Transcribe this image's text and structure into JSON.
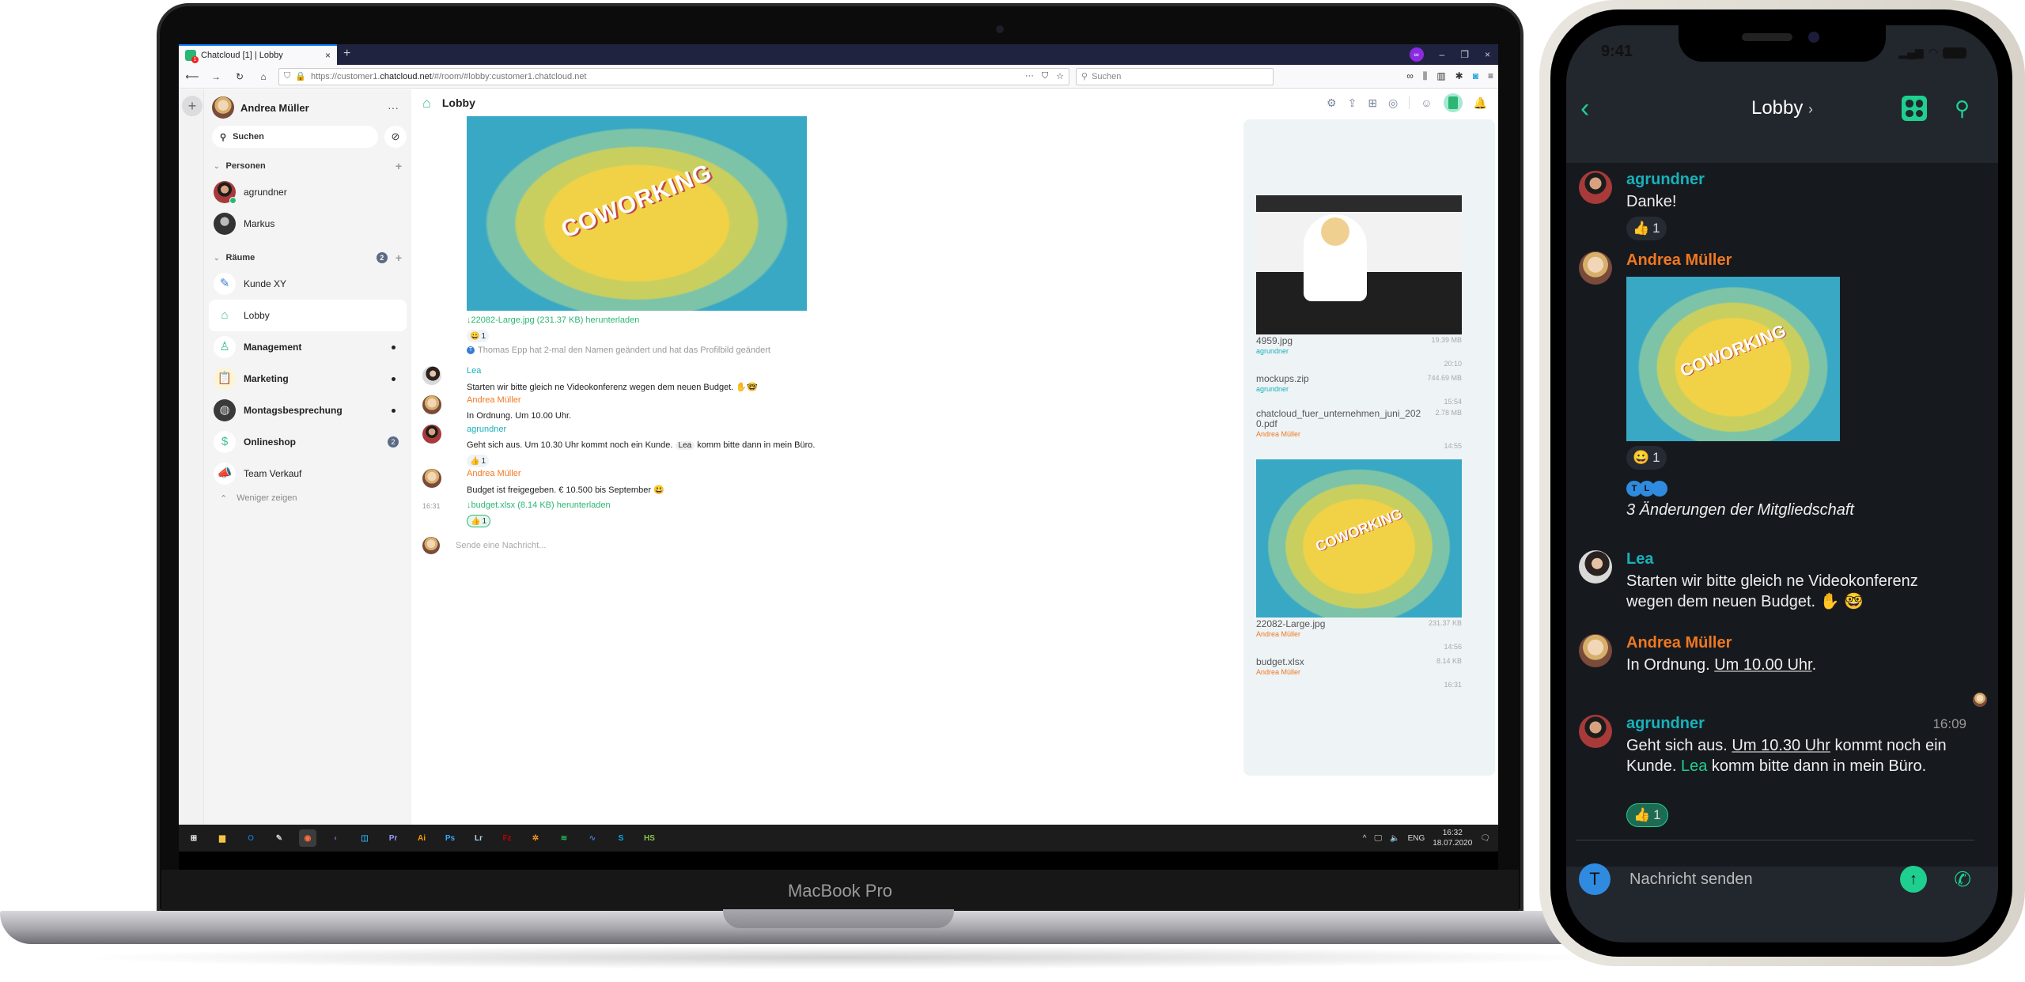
{
  "laptop": {
    "brand": "MacBook Pro",
    "browser": {
      "tab_title": "Chatcloud [1] | Lobby",
      "tab_close": "×",
      "new_tab": "+",
      "url_prefix": "https://customer1.",
      "url_domain": "chatcloud.net",
      "url_suffix": "/#/room/#lobby:customer1.chatcloud.net",
      "search_placeholder": "Suchen",
      "window_controls": [
        "–",
        "❐",
        "×"
      ]
    },
    "app": {
      "user_name": "Andrea Müller",
      "search_placeholder": "Suchen",
      "sections": {
        "people": {
          "label": "Personen"
        },
        "rooms": {
          "label": "Räume",
          "count": "2"
        }
      },
      "people": [
        {
          "name": "agrundner",
          "online": true
        },
        {
          "name": "Markus",
          "online": false
        }
      ],
      "rooms": [
        {
          "name": "Kunde XY",
          "icon": "pencil-icon"
        },
        {
          "name": "Lobby",
          "icon": "house-icon",
          "active": true
        },
        {
          "name": "Management",
          "icon": "user-shield-icon",
          "unread": "dot"
        },
        {
          "name": "Marketing",
          "icon": "clipboard-icon",
          "unread": "dot"
        },
        {
          "name": "Montagsbesprechung",
          "icon": "meeting-photo",
          "unread": "dot"
        },
        {
          "name": "Onlineshop",
          "icon": "money-chat-icon",
          "unread_count": "2"
        },
        {
          "name": "Team Verkauf",
          "icon": "megaphone-icon"
        }
      ],
      "show_less": "Weniger zeigen",
      "room_title": "Lobby",
      "image_label": "COWORKING",
      "timeline": {
        "image_link": "↓22082-Large.jpg (231.37 KB) herunterladen",
        "image_reaction": {
          "emoji": "😀",
          "count": "1"
        },
        "notice": "Thomas Epp hat 2-mal den Namen geändert und hat das Profilbild geändert",
        "notice_initial": "T",
        "messages": [
          {
            "sender": "Lea",
            "body": "Starten wir bitte gleich ne Videokonferenz wegen dem neuen Budget. ✋🤓"
          },
          {
            "sender": "Andrea Müller",
            "body": "In Ordnung. Um 10.00 Uhr."
          },
          {
            "sender": "agrundner",
            "body_before": "Geht sich aus. Um 10.30 Uhr kommt noch ein Kunde.",
            "mention": "Lea",
            "body_after": "komm bitte dann in mein Büro.",
            "reaction": {
              "emoji": "👍",
              "count": "1"
            }
          },
          {
            "sender": "Andrea Müller",
            "body": "Budget ist freigegeben. € 10.500 bis September 😃",
            "time": "16:31",
            "link": "↓budget.xlsx (8.14 KB) herunterladen",
            "reaction": {
              "emoji": "👍",
              "count": "1"
            }
          }
        ],
        "composer_placeholder": "Sende eine Nachricht..."
      },
      "files": [
        {
          "name": "4959.jpg",
          "user": "agrundner",
          "size": "19.39 MB",
          "time": "20:10"
        },
        {
          "name": "mockups.zip",
          "user": "agrundner",
          "size": "744.69 MB",
          "time": "15:54"
        },
        {
          "name": "chatcloud_fuer_unternehmen_juni_2020.pdf",
          "user": "Andrea Müller",
          "size": "2.78 MB",
          "time": "14:55"
        },
        {
          "name": "22082-Large.jpg",
          "user": "Andrea Müller",
          "size": "231.37 KB",
          "time": "14:56"
        },
        {
          "name": "budget.xlsx",
          "user": "Andrea Müller",
          "size": "8.14 KB",
          "time": "16:31"
        }
      ]
    },
    "taskbar": {
      "apps": [
        {
          "name": "start",
          "glyph": "⊞",
          "color": "#ffffff"
        },
        {
          "name": "explorer",
          "glyph": "▆",
          "color": "#f4c542"
        },
        {
          "name": "outlook",
          "glyph": "O",
          "color": "#0f6cbd"
        },
        {
          "name": "tool",
          "glyph": "✎",
          "color": "#d0d0d0"
        },
        {
          "name": "firefox",
          "glyph": "◉",
          "color": "#ff7139",
          "active": true
        },
        {
          "name": "tor",
          "glyph": "◐",
          "color": "#7d4698"
        },
        {
          "name": "app-blue",
          "glyph": "◫",
          "color": "#29a8e0"
        },
        {
          "name": "premiere",
          "glyph": "Pr",
          "color": "#9999ff"
        },
        {
          "name": "illustrator",
          "glyph": "Ai",
          "color": "#ff9a00"
        },
        {
          "name": "photoshop",
          "glyph": "Ps",
          "color": "#31a8ff"
        },
        {
          "name": "lightroom",
          "glyph": "Lr",
          "color": "#add5ec"
        },
        {
          "name": "filezilla",
          "glyph": "Fz",
          "color": "#bf0000"
        },
        {
          "name": "settings-app",
          "glyph": "✲",
          "color": "#f7941d"
        },
        {
          "name": "spotify",
          "glyph": "≋",
          "color": "#1db954"
        },
        {
          "name": "monitor",
          "glyph": "∿",
          "color": "#3a7bd5"
        },
        {
          "name": "skype",
          "glyph": "S",
          "color": "#00aff0"
        },
        {
          "name": "hs",
          "glyph": "HS",
          "color": "#8bc34a"
        }
      ],
      "tray": {
        "language": "ENG",
        "time": "16:32",
        "date": "18.07.2020"
      }
    }
  },
  "phone": {
    "status_time": "9:41",
    "title": "Lobby",
    "composer_placeholder": "Nachricht senden",
    "composer_avatar": "T",
    "image_label": "COWORKING",
    "messages": [
      {
        "sender": "agrundner",
        "body": "Danke!",
        "reaction": {
          "emoji": "👍",
          "count": "1"
        }
      },
      {
        "sender": "Andrea Müller",
        "reaction": {
          "emoji": "😀",
          "count": "1"
        }
      },
      {
        "sender": "Lea",
        "body": "Starten wir bitte gleich ne Videokonferenz wegen dem neuen Budget. ✋ 🤓"
      },
      {
        "sender": "Andrea Müller",
        "body_before": "In Ordnung.",
        "body_link": "Um 10.00 Uhr",
        "body_after": "."
      },
      {
        "sender": "agrundner",
        "time": "16:09",
        "body_before": "Geht sich aus.",
        "body_link": "Um 10.30 Uhr",
        "body_mid": "kommt noch ein Kunde.",
        "mention": "Lea",
        "body_after": "komm bitte dann in mein Büro.",
        "reaction": {
          "emoji": "👍",
          "count": "1"
        }
      }
    ],
    "membership": {
      "initials": [
        "T",
        "L"
      ],
      "text": "3 Änderungen der Mitgliedschaft"
    }
  }
}
